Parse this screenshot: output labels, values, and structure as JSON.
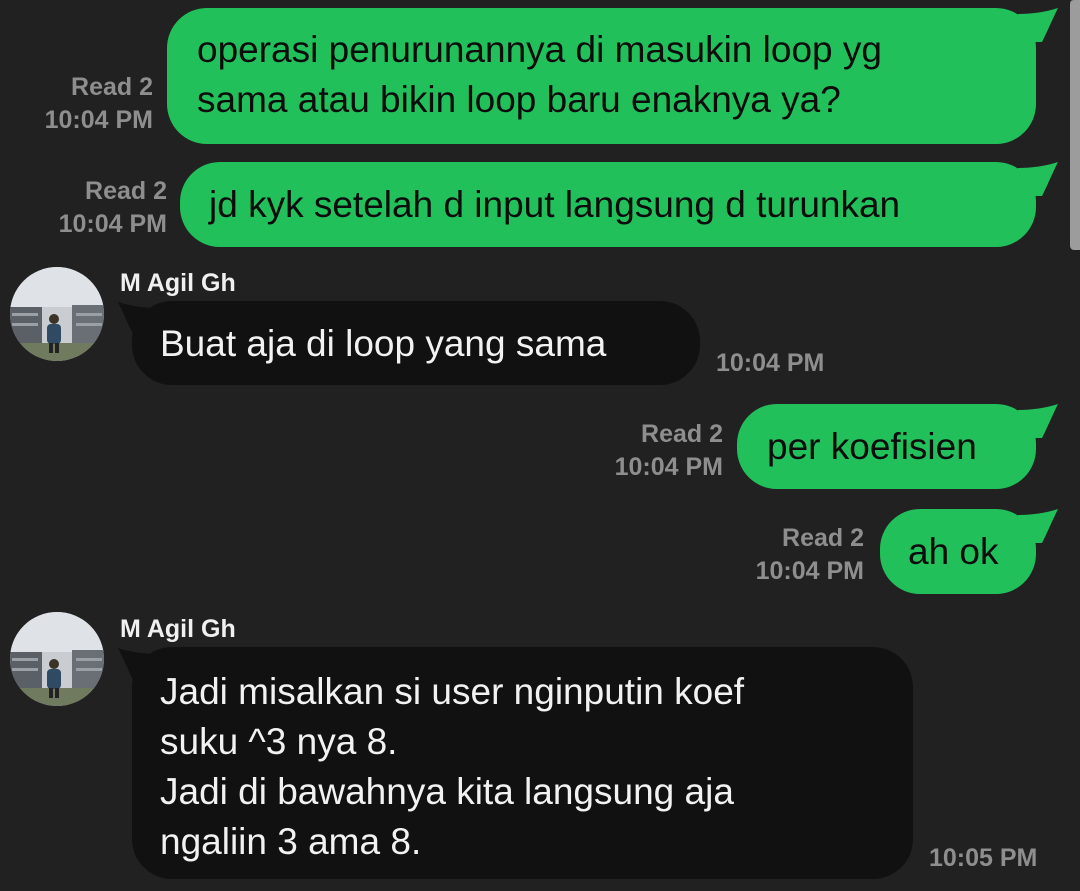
{
  "messages": [
    {
      "direction": "outgoing",
      "read": "Read 2",
      "time": "10:04 PM",
      "lines": [
        "operasi penurunannya di masukin loop yg",
        "sama atau bikin loop baru enaknya ya?"
      ]
    },
    {
      "direction": "outgoing",
      "read": "Read 2",
      "time": "10:04 PM",
      "lines": [
        "jd kyk setelah d input langsung d turunkan"
      ]
    },
    {
      "direction": "incoming",
      "sender": "M Agil Gh",
      "time": "10:04 PM",
      "lines": [
        "Buat aja di loop yang sama"
      ]
    },
    {
      "direction": "outgoing",
      "read": "Read 2",
      "time": "10:04 PM",
      "lines": [
        "per koefisien"
      ]
    },
    {
      "direction": "outgoing",
      "read": "Read 2",
      "time": "10:04 PM",
      "lines": [
        "ah ok"
      ]
    },
    {
      "direction": "incoming",
      "sender": "M Agil Gh",
      "time": "10:05 PM",
      "lines": [
        "Jadi misalkan si user nginputin koef",
        "suku ^3 nya 8.",
        "Jadi di bawahnya kita langsung aja",
        "ngaliin 3 ama 8."
      ]
    }
  ],
  "colors": {
    "background": "#212121",
    "outgoing_bubble": "#22c05a",
    "incoming_bubble": "#111111",
    "meta_text": "#8e8e8e"
  },
  "icons": {
    "avatar": "user-avatar-photo",
    "tail": "bubble-tail"
  }
}
